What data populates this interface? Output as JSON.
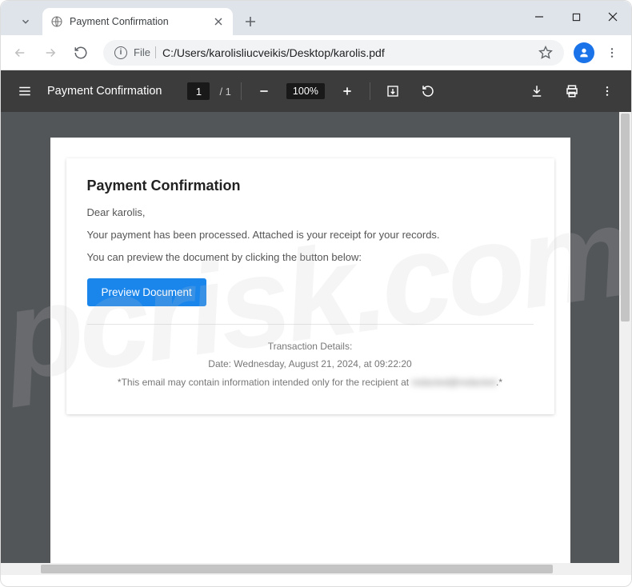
{
  "tab": {
    "title": "Payment Confirmation"
  },
  "url": {
    "scheme_label": "File",
    "path": "C:/Users/karolisliucveikis/Desktop/karolis.pdf"
  },
  "pdf": {
    "title": "Payment Confirmation",
    "page_current": "1",
    "page_total": "/ 1",
    "zoom": "100%"
  },
  "doc": {
    "heading": "Payment Confirmation",
    "greeting": "Dear karolis,",
    "line1": "Your payment has been processed. Attached is your receipt for your records.",
    "line2": "You can preview the document by clicking the button below:",
    "button": "Preview Document",
    "details_header": "Transaction Details:",
    "details_date": "Date: Wednesday, August 21, 2024, at 09:22:20",
    "details_notice_pre": "*This email may contain information intended only for the recipient at ",
    "details_notice_blur": "redacted@redacted",
    "details_notice_post": ".*"
  },
  "watermark": "pcrisk.com"
}
